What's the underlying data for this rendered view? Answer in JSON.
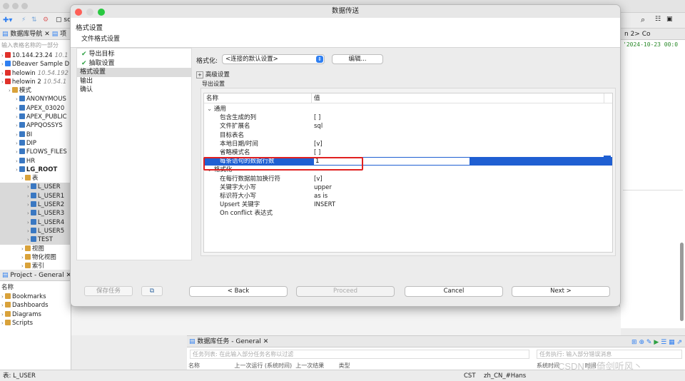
{
  "ide": {
    "toolbar_fragment": "sc",
    "nav_tab_label": "数据库导航",
    "nav_tab_label2": "项",
    "filter_placeholder": "输入表格名称的一部分",
    "tree": [
      {
        "label": "10.144.23.24",
        "extra": "10.1"
      },
      {
        "label": "DBeaver Sample D"
      },
      {
        "label": "helowin",
        "extra": "10.54.192"
      },
      {
        "label": "helowin 2",
        "extra": "10.54.1"
      },
      {
        "label": "模式"
      },
      {
        "label": "ANONYMOUS"
      },
      {
        "label": "APEX_03020"
      },
      {
        "label": "APEX_PUBLIC"
      },
      {
        "label": "APPQOSSYS"
      },
      {
        "label": "BI"
      },
      {
        "label": "DIP"
      },
      {
        "label": "FLOWS_FILES"
      },
      {
        "label": "HR"
      },
      {
        "label": "LG_ROOT"
      },
      {
        "label": "表"
      },
      {
        "label": "L_USER"
      },
      {
        "label": "L_USER1"
      },
      {
        "label": "L_USER2"
      },
      {
        "label": "L_USER3"
      },
      {
        "label": "L_USER4"
      },
      {
        "label": "L_USER5"
      },
      {
        "label": "TEST"
      },
      {
        "label": "视图"
      },
      {
        "label": "物化视图"
      },
      {
        "label": "索引"
      }
    ],
    "project_tab": "Project - General",
    "project_header": "名称",
    "project_items": [
      "Bookmarks",
      "Dashboards",
      "Diagrams",
      "Scripts"
    ],
    "editor_tab": "n 2> Co",
    "editor_text": "'2024-10-23 00:0",
    "task_tab": "数据库任务 - General",
    "task_filter": "任务列表: 在此输入部分任务名称以过滤",
    "task_exec_filter": "任务执行: 输入部分错误消息",
    "task_cols": [
      "名称",
      "上一次运行 (系统时间)",
      "上一次结果",
      "类型"
    ],
    "task_col_right": "系统时间",
    "task_col_right2": "时间",
    "status_left": "表: L_USER",
    "status_tz": "CST",
    "status_locale": "zh_CN_#Hans",
    "watermark": "CSDN @倚剑听风丶"
  },
  "dialog": {
    "title": "数据传送",
    "header_title": "格式设置",
    "header_subtitle": "文件格式设置",
    "nav": [
      {
        "label": "导出目标",
        "done": true
      },
      {
        "label": "抽取设置",
        "done": true
      },
      {
        "label": "格式设置",
        "done": false,
        "selected": true
      },
      {
        "label": "输出",
        "done": false
      },
      {
        "label": "确认",
        "done": false
      }
    ],
    "save_task": "保存任务",
    "format_label": "格式化:",
    "format_value": "<连接的默认设置>",
    "edit_button": "编辑...",
    "advanced_label": "高级设置",
    "export_group": "导出设置",
    "grid_headers": {
      "name": "名称",
      "value": "值"
    },
    "rows": [
      {
        "name": "通用",
        "value": "",
        "group": true
      },
      {
        "name": "包含生成的列",
        "value": "[ ]"
      },
      {
        "name": "文件扩展名",
        "value": "sql"
      },
      {
        "name": "目标表名",
        "value": ""
      },
      {
        "name": "本地日期/时间",
        "value": "[v]"
      },
      {
        "name": "省略模式名",
        "value": "[ ]"
      },
      {
        "name": "每条语句的数据行数",
        "value": "1",
        "highlight": true
      },
      {
        "name": "格式化",
        "value": "",
        "group": true
      },
      {
        "name": "在每行数据前加换行符",
        "value": "[v]"
      },
      {
        "name": "关键字大小写",
        "value": "upper"
      },
      {
        "name": "标识符大小写",
        "value": "as is"
      },
      {
        "name": "Upsert 关键字",
        "value": "INSERT"
      },
      {
        "name": "On conflict 表达式",
        "value": ""
      }
    ],
    "buttons": {
      "back": "< Back",
      "proceed": "Proceed",
      "cancel": "Cancel",
      "next": "Next >"
    }
  },
  "colors": {
    "accent": "#1f5fd2",
    "red_box": "#e02020",
    "check": "#2ea043"
  }
}
